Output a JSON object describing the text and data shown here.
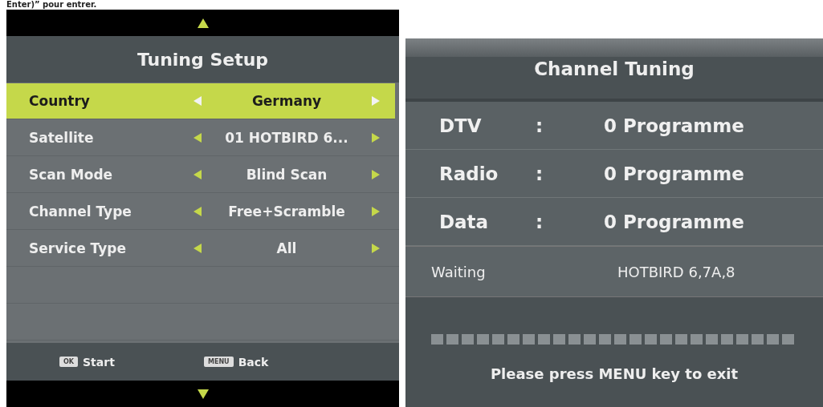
{
  "caption": "Enter)” pour entrer.",
  "tuning_setup": {
    "title": "Tuning Setup",
    "rows": [
      {
        "label": "Country",
        "value": "Germany",
        "selected": true
      },
      {
        "label": "Satellite",
        "value": "01 HOTBIRD 6...",
        "selected": false
      },
      {
        "label": "Scan Mode",
        "value": "Blind Scan",
        "selected": false
      },
      {
        "label": "Channel Type",
        "value": "Free+Scramble",
        "selected": false
      },
      {
        "label": "Service Type",
        "value": "All",
        "selected": false
      }
    ],
    "hints": [
      {
        "key": "OK",
        "label": "Start"
      },
      {
        "key": "MENU",
        "label": "Back"
      }
    ]
  },
  "channel_tuning": {
    "title": "Channel Tuning",
    "counts": [
      {
        "label": "DTV",
        "separator": ":",
        "value": "0 Programme"
      },
      {
        "label": "Radio",
        "separator": ":",
        "value": "0 Programme"
      },
      {
        "label": "Data",
        "separator": ":",
        "value": "0 Programme"
      }
    ],
    "status": {
      "label": "Waiting",
      "value": "HOTBIRD 6,7A,8"
    },
    "message": "Please press MENU key to exit"
  }
}
